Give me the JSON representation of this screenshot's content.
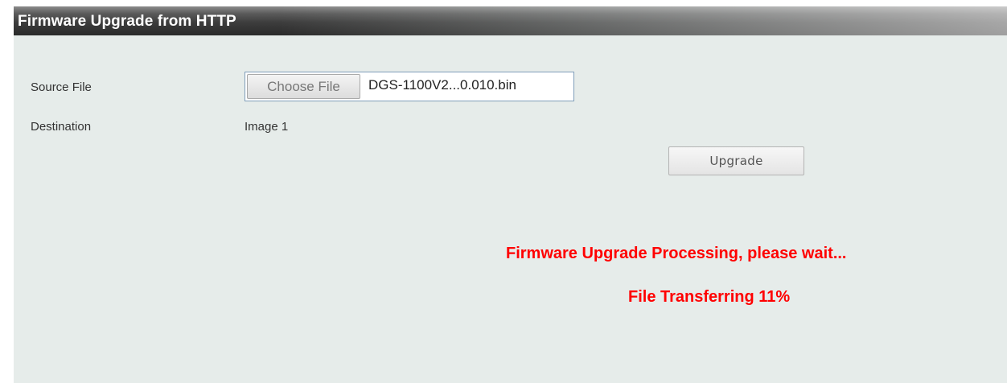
{
  "header": {
    "title": "Firmware Upgrade from HTTP"
  },
  "form": {
    "source_file_label": "Source File",
    "choose_file_label": "Choose File",
    "selected_file_name": "DGS-1100V2...0.010.bin",
    "destination_label": "Destination",
    "destination_value": "Image 1",
    "upgrade_label": "Upgrade"
  },
  "status": {
    "processing_message": "Firmware Upgrade Processing, please wait...",
    "transfer_message": "File Transferring 11%",
    "transfer_progress_percent": 11,
    "color": "#ff0000"
  }
}
